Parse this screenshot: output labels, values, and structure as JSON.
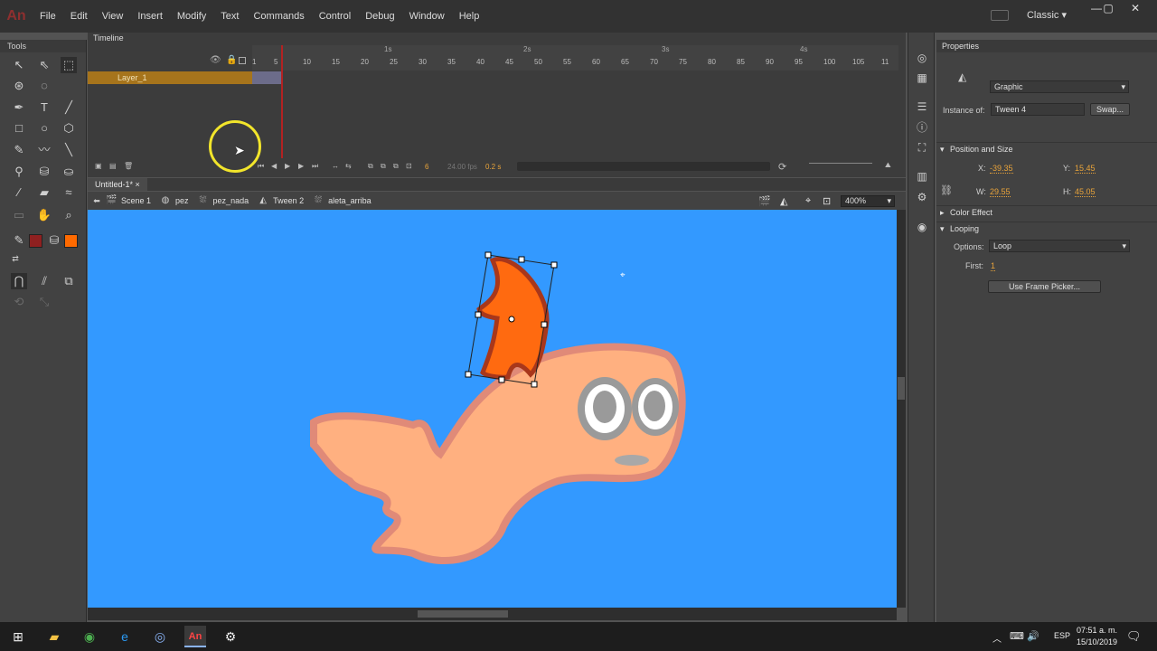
{
  "app": {
    "logo": "An",
    "workspace": "Classic"
  },
  "menu": [
    "File",
    "Edit",
    "View",
    "Insert",
    "Modify",
    "Text",
    "Commands",
    "Control",
    "Debug",
    "Window",
    "Help"
  ],
  "tools_panel": {
    "title": "Tools"
  },
  "timeline": {
    "title": "Timeline",
    "layer_name": "Layer_1",
    "seconds": [
      "1s",
      "2s",
      "3s",
      "4s"
    ],
    "frame_numbers": [
      "1",
      "5",
      "10",
      "15",
      "20",
      "25",
      "30",
      "35",
      "40",
      "45",
      "50",
      "55",
      "60",
      "65",
      "70",
      "75",
      "80",
      "85",
      "90",
      "95",
      "100",
      "105",
      "11"
    ],
    "current_frame": "6",
    "fps": "24.00 fps",
    "time": "0.2 s"
  },
  "document": {
    "tab": "Untitled-1*"
  },
  "breadcrumbs": [
    {
      "icon": "scene-icon",
      "label": "Scene 1"
    },
    {
      "icon": "graphic-symbol-icon",
      "label": "pez"
    },
    {
      "icon": "movieclip-icon",
      "label": "pez_nada"
    },
    {
      "icon": "graphic-symbol-icon",
      "label": "Tween 2"
    },
    {
      "icon": "movieclip-icon",
      "label": "aleta_arriba"
    }
  ],
  "zoom": "400%",
  "properties": {
    "title": "Properties",
    "symbol_behavior": "Graphic",
    "instance_of_label": "Instance of:",
    "instance_of": "Tween 4",
    "swap_label": "Swap...",
    "position_size": {
      "title": "Position and Size",
      "x_label": "X:",
      "x": "-39.35",
      "y_label": "Y:",
      "y": "15.45",
      "w_label": "W:",
      "w": "29.55",
      "h_label": "H:",
      "h": "45.05"
    },
    "color_effect_title": "Color Effect",
    "looping": {
      "title": "Looping",
      "options_label": "Options:",
      "options": "Loop",
      "first_label": "First:",
      "first": "1",
      "frame_picker_label": "Use Frame Picker..."
    }
  },
  "taskbar": {
    "lang": "ESP",
    "time": "07:51 a. m.",
    "date": "15/10/2019"
  },
  "colors": {
    "stage": "#3399ff",
    "fish_body": "#ffb080",
    "fin": "#ff6a10",
    "fin_outline": "#a8371b",
    "stroke_color": "#8f2020",
    "fill_color": "#ff6a00"
  }
}
